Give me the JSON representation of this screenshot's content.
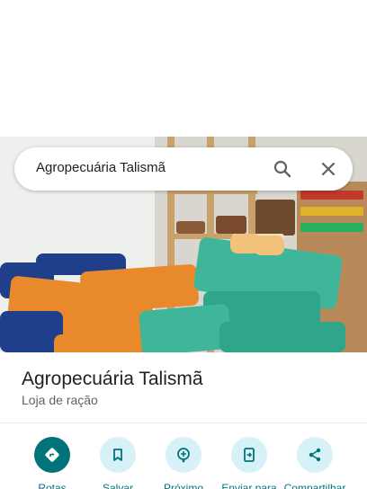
{
  "search": {
    "query": "Agropecuária Talismã",
    "search_icon": "search-icon",
    "close_icon": "close-icon"
  },
  "place": {
    "title": "Agropecuária Talismã",
    "category": "Loja de ração"
  },
  "actions": [
    {
      "label": "Rotas",
      "icon": "directions-icon"
    },
    {
      "label": "Salvar",
      "icon": "bookmark-icon"
    },
    {
      "label": "Próximo",
      "icon": "nearby-icon"
    },
    {
      "label": "Enviar para",
      "icon": "send-to-phone-icon"
    },
    {
      "label": "Compartilhar",
      "icon": "share-icon"
    }
  ],
  "colors": {
    "accent": "#00737b",
    "accent_light": "#d6f1f7",
    "text_primary": "#202124",
    "text_secondary": "#5f6368"
  }
}
